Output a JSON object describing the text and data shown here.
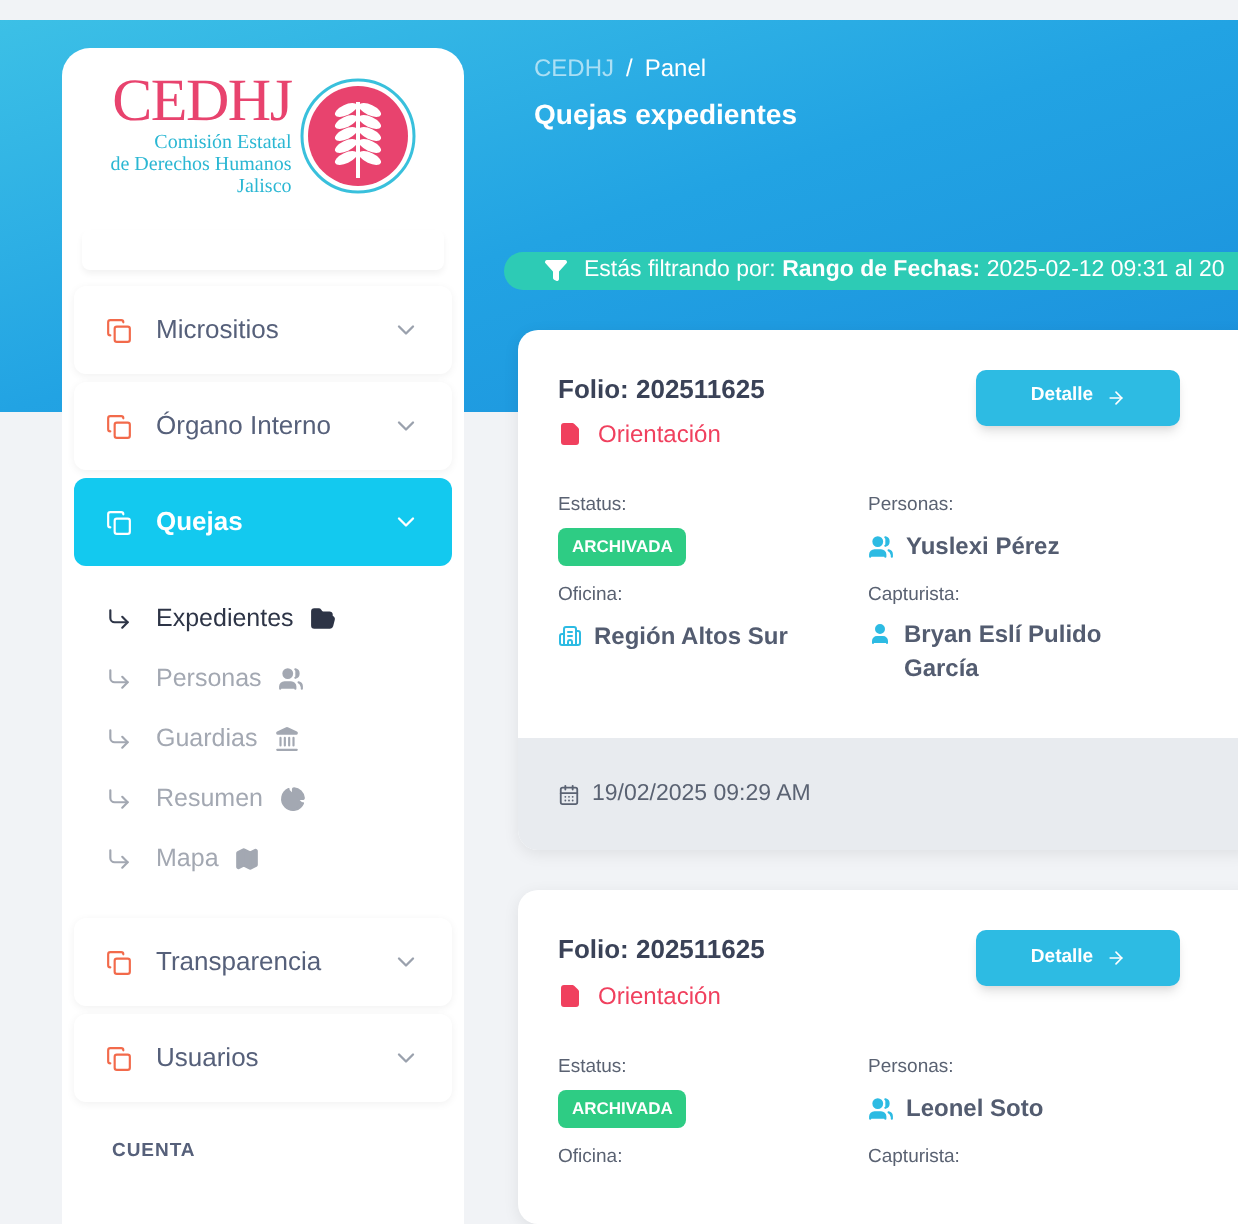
{
  "logo": {
    "acronym": "CEDHJ",
    "lines": [
      "Comisión Estatal",
      "de Derechos Humanos",
      "Jalisco"
    ]
  },
  "sidebar": {
    "items": [
      {
        "label": "Micrositios",
        "expanded": false
      },
      {
        "label": "Órgano Interno",
        "expanded": false
      },
      {
        "label": "Quejas",
        "expanded": true,
        "children": [
          {
            "label": "Expedientes",
            "selected": true
          },
          {
            "label": "Personas",
            "selected": false
          },
          {
            "label": "Guardias",
            "selected": false
          },
          {
            "label": "Resumen",
            "selected": false
          },
          {
            "label": "Mapa",
            "selected": false
          }
        ]
      },
      {
        "label": "Transparencia",
        "expanded": false
      },
      {
        "label": "Usuarios",
        "expanded": false
      }
    ],
    "section_heading": "CUENTA"
  },
  "breadcrumb": [
    "CEDHJ",
    "Panel"
  ],
  "breadcrumb_separator": "/",
  "page_title": "Quejas expedientes",
  "filter": {
    "prefix": "Estás filtrando por:",
    "name": "Rango de Fechas:",
    "value": "2025-02-12 09:31 al 20"
  },
  "cards": [
    {
      "folio": "Folio: 202511625",
      "type": "Orientación",
      "button": "Detalle",
      "status_label": "Estatus:",
      "status": "ARCHIVADA",
      "persons_label": "Personas:",
      "persons": "Yuslexi Pérez",
      "office_label": "Oficina:",
      "office": "Región Altos Sur",
      "capturist_label": "Capturista:",
      "capturist": "Bryan Eslí Pulido García",
      "date": "19/02/2025 09:29 AM"
    },
    {
      "folio": "Folio: 202511625",
      "type": "Orientación",
      "button": "Detalle",
      "status_label": "Estatus:",
      "status": "ARCHIVADA",
      "persons_label": "Personas:",
      "persons": "Leonel Soto",
      "office_label": "Oficina:",
      "capturist_label": "Capturista:"
    }
  ]
}
